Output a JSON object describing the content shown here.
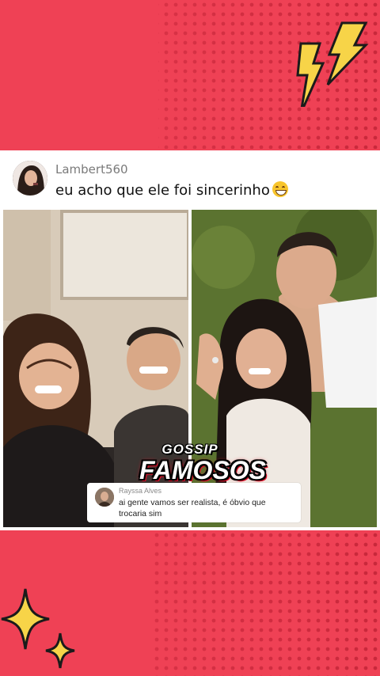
{
  "comment": {
    "username": "Lambert560",
    "text": "eu acho que ele foi sincerinho",
    "emoji_icon": "grinning-face-icon"
  },
  "reply": {
    "username": "Rayssa Alves",
    "text": "ai gente vamos ser realista, é óbvio que trocaria sim"
  },
  "watermark": {
    "line1": "GOSSIP",
    "line2": "FAMOSOS"
  },
  "colors": {
    "background": "#ef4155",
    "dots": "#c8283b",
    "bolt": "#f7d448",
    "sparkle": "#f7d448"
  }
}
